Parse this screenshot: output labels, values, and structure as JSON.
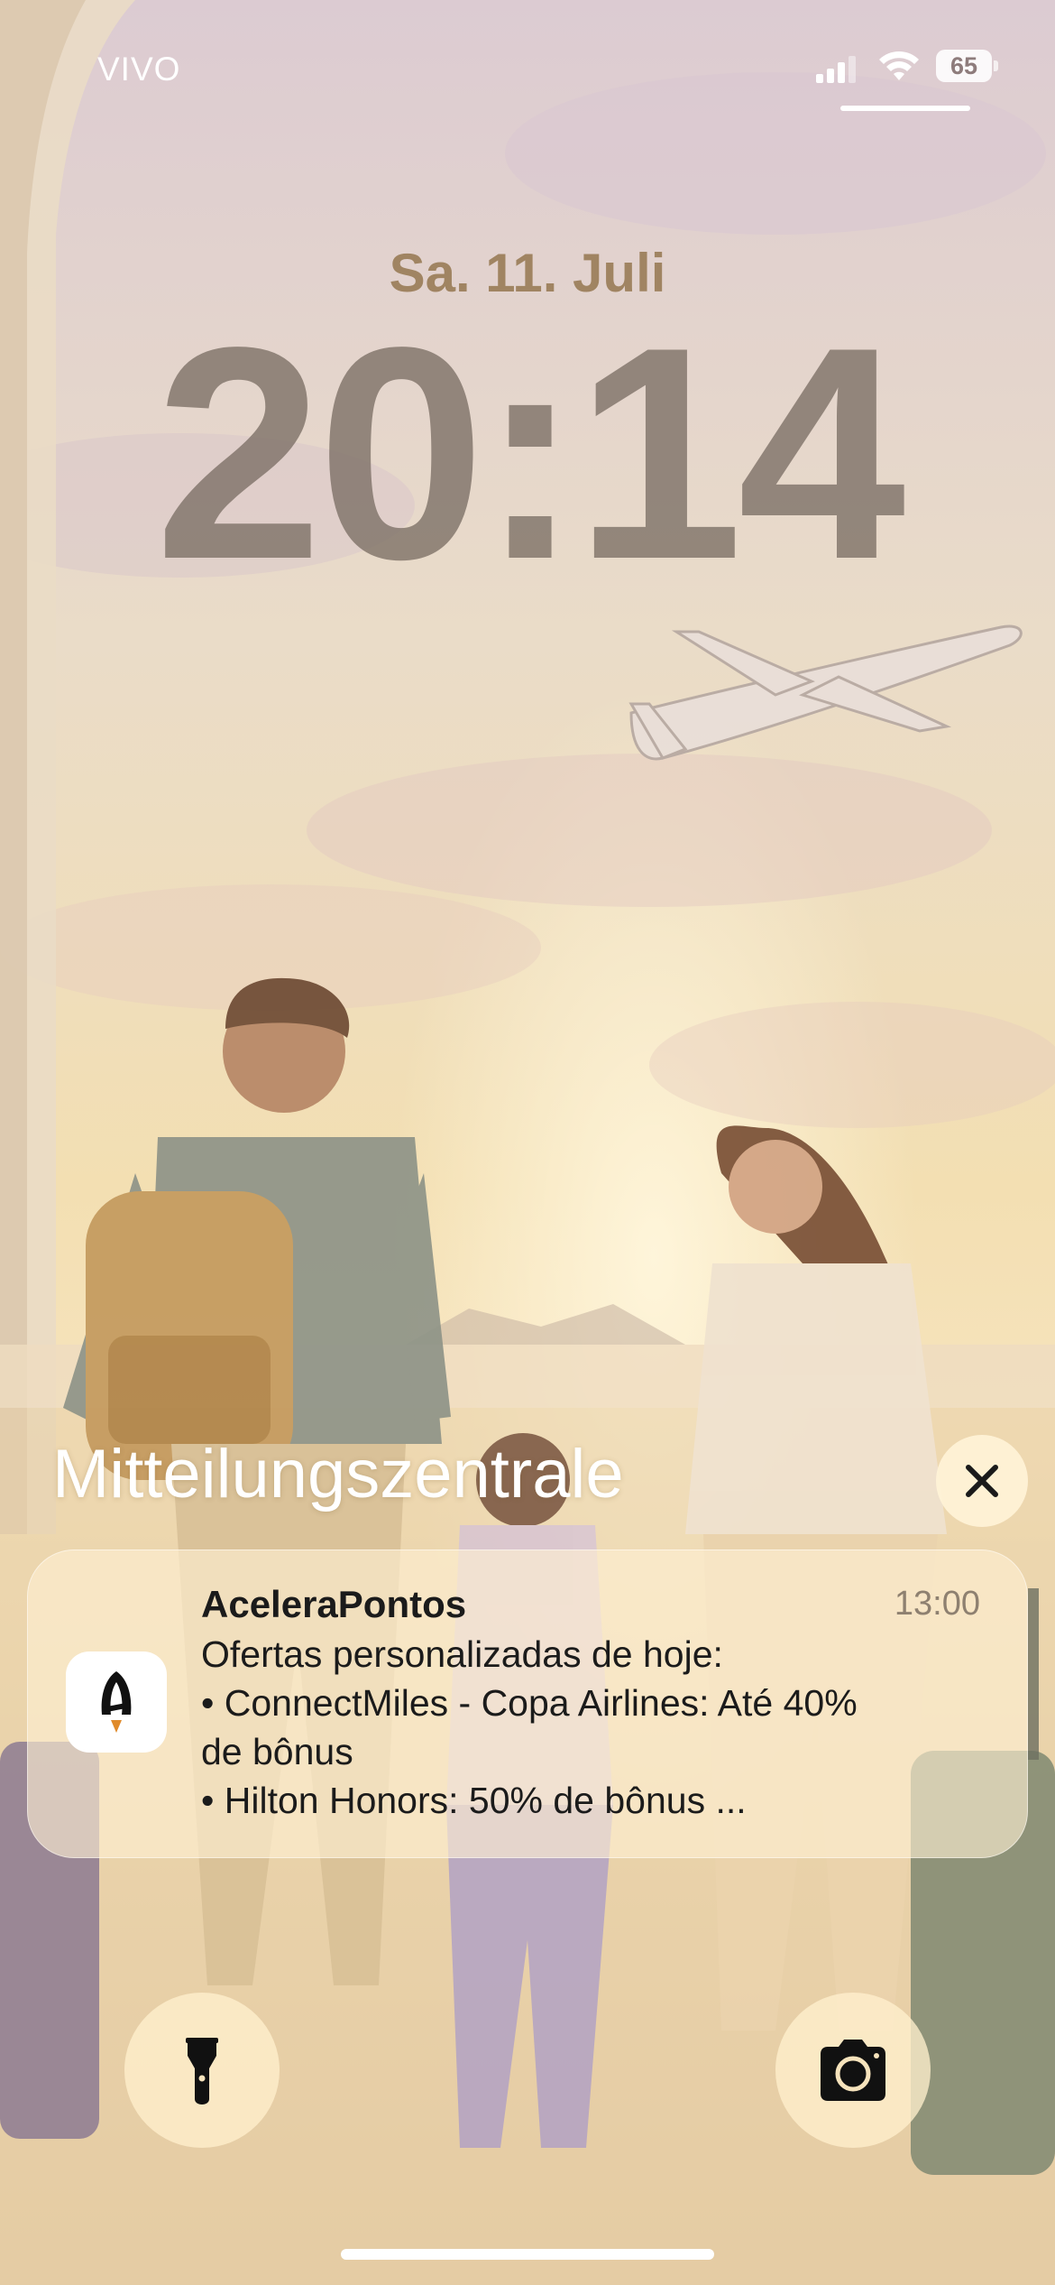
{
  "status_bar": {
    "carrier": "VIVO",
    "battery_level": "65",
    "icons": [
      "cellular-signal-icon",
      "wifi-icon",
      "battery-icon"
    ]
  },
  "lock_screen": {
    "date": "Sa. 11. Juli",
    "time": "20:14"
  },
  "notification_center": {
    "title": "Mitteilungszentrale",
    "close_icon": "close-icon"
  },
  "notification": {
    "app_name": "AceleraPontos",
    "time": "13:00",
    "app_icon": "acelerapontos-logo-icon",
    "lines": [
      "Ofertas personalizadas de hoje:",
      "• ConnectMiles - Copa Airlines: Até 40%",
      "de bônus",
      "• Hilton Honors: 50% de bônus   ..."
    ]
  },
  "quick_actions": {
    "left": "flashlight-icon",
    "right": "camera-icon"
  },
  "colors": {
    "date": "#a08462",
    "time": "#7d7066",
    "notification_bg": "#fff0d4",
    "button_bg": "#fff0cd",
    "icon_dark": "#111111"
  }
}
